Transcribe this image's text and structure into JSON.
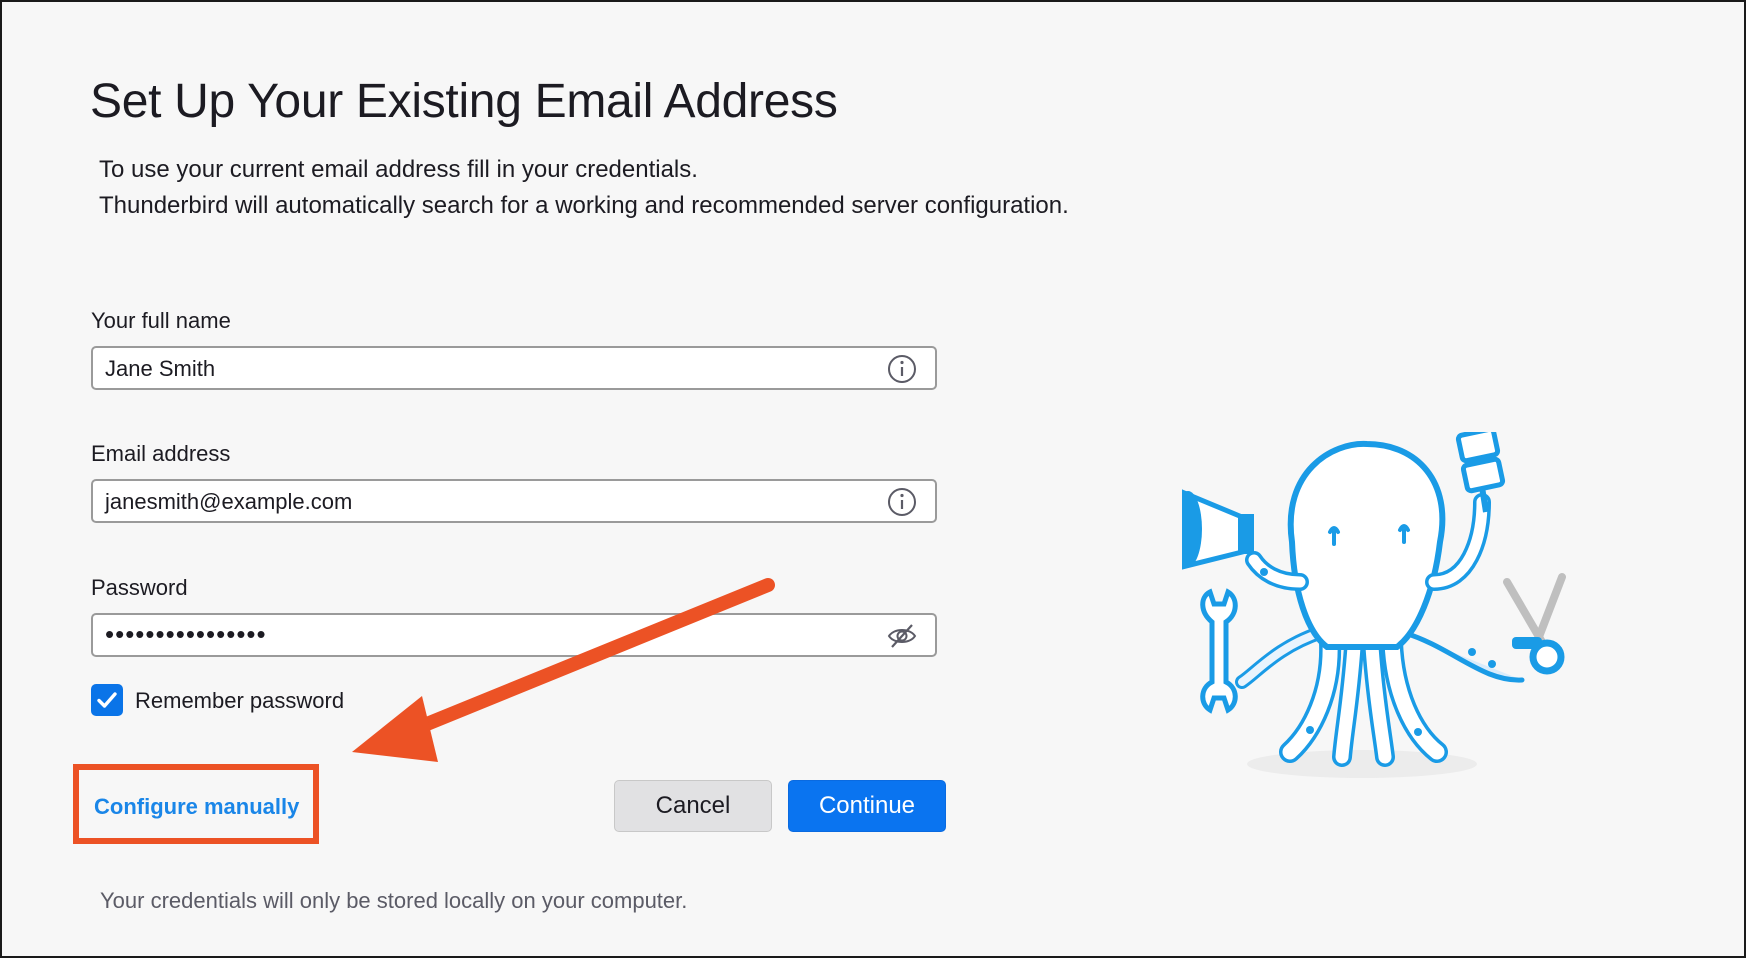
{
  "page": {
    "title": "Set Up Your Existing Email Address",
    "description": [
      "To use your current email address fill in your credentials.",
      "Thunderbird will automatically search for a working and recommended server configuration."
    ]
  },
  "form": {
    "full_name": {
      "label": "Your full name",
      "value": "Jane Smith",
      "icon": "info-icon"
    },
    "email": {
      "label": "Email address",
      "value": "janesmith@example.com",
      "icon": "info-icon"
    },
    "password": {
      "label": "Password",
      "value": "••••••••••••••••",
      "icon": "eye-slash-icon"
    },
    "remember": {
      "label": "Remember password",
      "checked": true
    }
  },
  "actions": {
    "configure_manually": "Configure manually",
    "cancel": "Cancel",
    "continue": "Continue"
  },
  "footer": "Your credentials will only be stored locally on your computer.",
  "colors": {
    "accent": "#0a74f0",
    "link": "#1a86e8",
    "annotation": "#ec5225",
    "mascot": "#1a9be6"
  }
}
